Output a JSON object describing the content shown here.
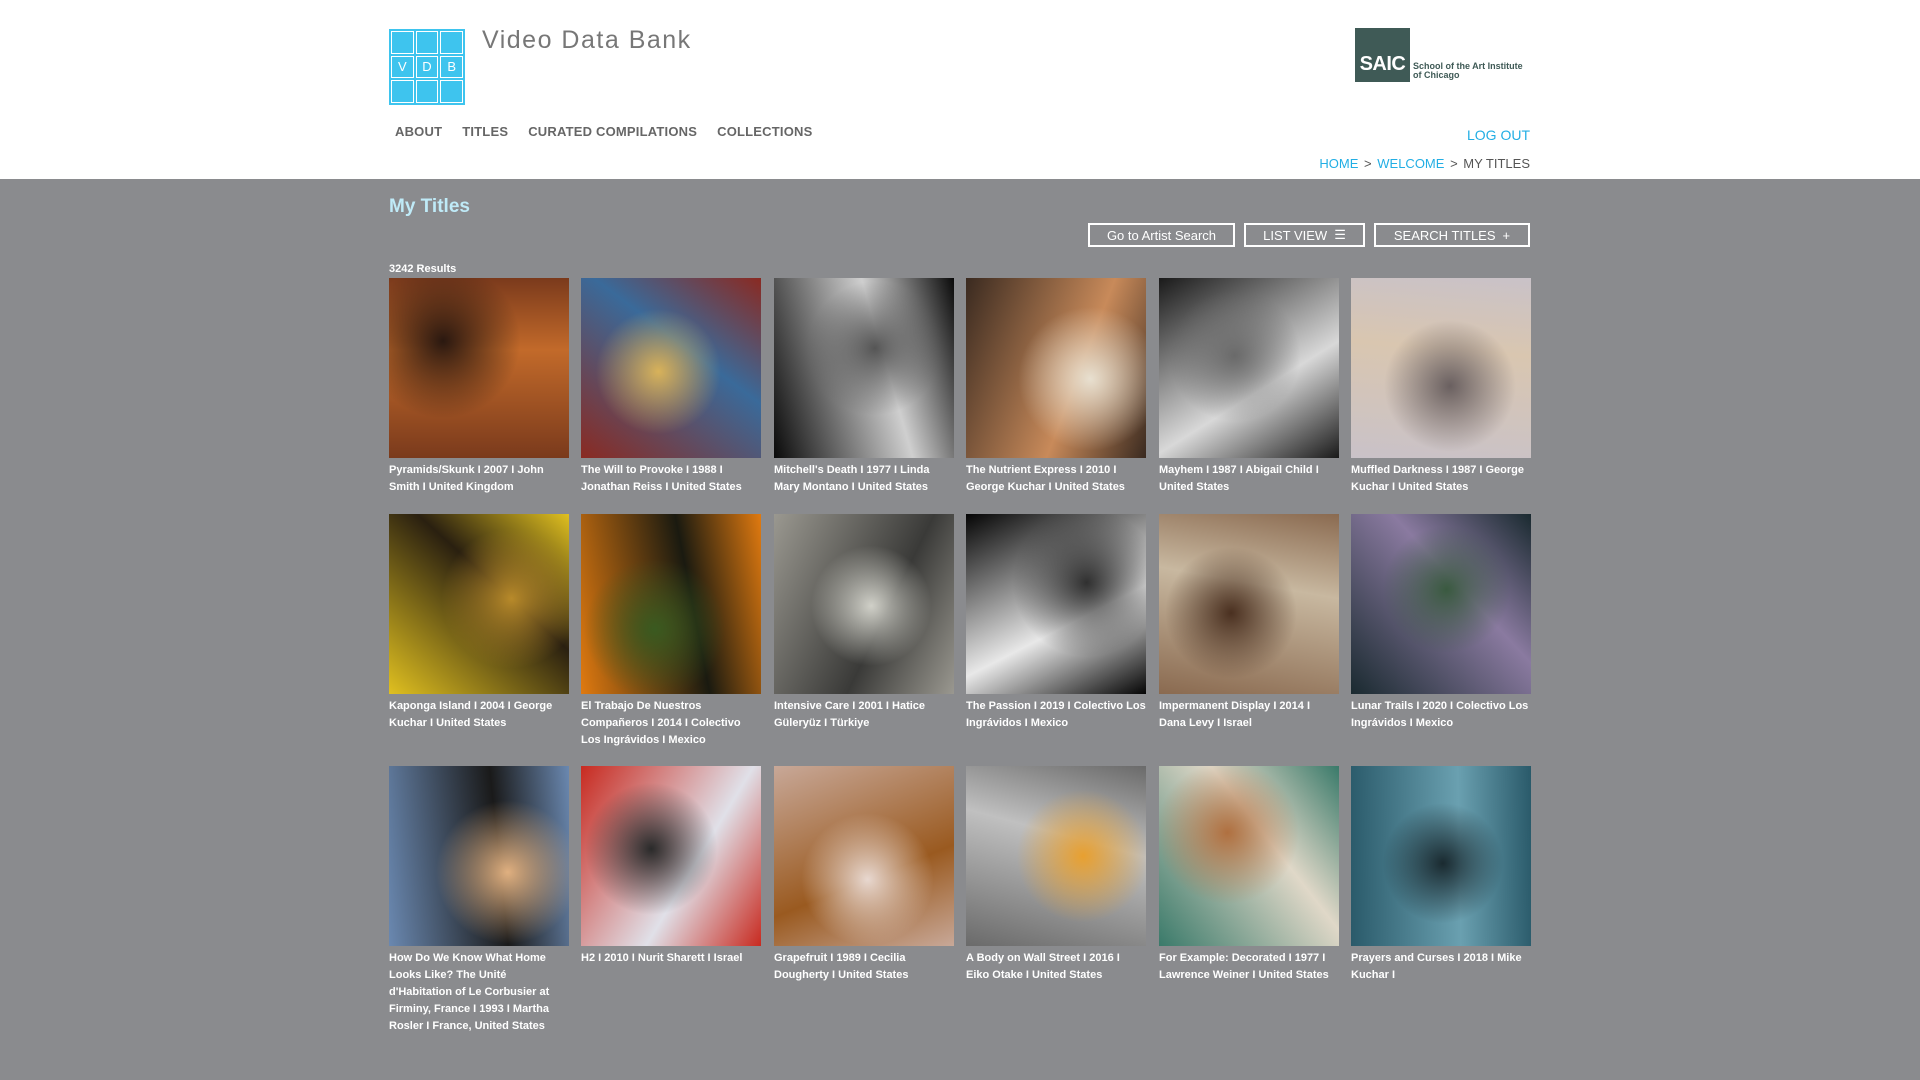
{
  "header": {
    "logo_letters": [
      "V",
      "D",
      "B"
    ],
    "site_title": "Video Data Bank",
    "partner_logo_text": "SAIC",
    "partner_name": "School of the Art Institute of Chicago",
    "nav": [
      {
        "label": "ABOUT"
      },
      {
        "label": "TITLES"
      },
      {
        "label": "CURATED COMPILATIONS"
      },
      {
        "label": "COLLECTIONS"
      }
    ],
    "logout_label": "LOG OUT",
    "breadcrumb": {
      "home": "HOME",
      "welcome": "WELCOME",
      "current": "MY TITLES",
      "separator": ">"
    }
  },
  "main": {
    "page_title": "My Titles",
    "toolbar": {
      "artist_search_label": "Go to Artist Search",
      "list_view_label": "LIST VIEW",
      "list_view_icon": "list-icon",
      "search_titles_label": "SEARCH TITLES",
      "search_titles_icon": "plus-icon"
    },
    "results_count": "3242 Results",
    "titles": [
      {
        "caption": "Pyramids/Skunk I 2007 I John Smith I United Kingdom",
        "palette": [
          "#7a3a1c",
          "#c26a2a",
          "#2a1810"
        ]
      },
      {
        "caption": "The Will to Provoke I 1988 I Jonathan Reiss I United States",
        "palette": [
          "#8a2a22",
          "#3a6a9a",
          "#d8b25a"
        ]
      },
      {
        "caption": "Mitchell's Death I 1977 I Linda Mary Montano I United States",
        "palette": [
          "#0a0a0a",
          "#cfcfcf",
          "#555555"
        ]
      },
      {
        "caption": "The Nutrient Express I 2010 I George Kuchar I United States",
        "palette": [
          "#3a2a20",
          "#c88a5a",
          "#e8e0d0"
        ]
      },
      {
        "caption": "Mayhem I 1987 I Abigail Child I United States",
        "palette": [
          "#1a1a1a",
          "#d8d8d8",
          "#6a6a6a"
        ]
      },
      {
        "caption": "Muffled Darkness I 1987 I George Kuchar I United States",
        "palette": [
          "#c9c2c8",
          "#d9c6b0",
          "#6a6060"
        ]
      },
      {
        "caption": "Kaponga Island I 2004 I George Kuchar I United States",
        "palette": [
          "#e0c020",
          "#2a2010",
          "#b88a2a"
        ]
      },
      {
        "caption": "El Trabajo De Nuestros Compañeros I 2014 I Colectivo Los Ingrávidos I Mexico",
        "palette": [
          "#e07a10",
          "#1a1a10",
          "#3a5a20"
        ]
      },
      {
        "caption": "Intensive Care I 2001 I Hatice Güleryüz I Türkiye",
        "palette": [
          "#9a9890",
          "#3a3a38",
          "#d0d0c8"
        ]
      },
      {
        "caption": "The Passion I 2019 I Colectivo Los Ingrávidos I Mexico",
        "palette": [
          "#050505",
          "#e8e8e8",
          "#303030"
        ]
      },
      {
        "caption": "Impermanent Display I 2014 I Dana Levy I Israel",
        "palette": [
          "#8a6a50",
          "#c8b8a0",
          "#4a3020"
        ]
      },
      {
        "caption": "Lunar Trails I 2020 I Colectivo Los Ingrávidos I Mexico",
        "palette": [
          "#1a2a30",
          "#8a7aa0",
          "#3a5a40"
        ]
      },
      {
        "caption": "How Do We Know What Home Looks Like? The Unité d'Habitation of Le Corbusier at Firminy, France I 1993 I Martha Rosler I France, United States",
        "palette": [
          "#6a88b0",
          "#1a1a1a",
          "#e0b080"
        ]
      },
      {
        "caption": "H2 I 2010 I Nurit Sharett I Israel",
        "palette": [
          "#c82a20",
          "#e0e0e8",
          "#2a2a2a"
        ]
      },
      {
        "caption": "Grapefruit I 1989 I Cecilia Dougherty I United States",
        "palette": [
          "#c8a898",
          "#9a5a20",
          "#e8d8d0"
        ]
      },
      {
        "caption": "A Body on Wall Street I 2016 I Eiko Otake I United States",
        "palette": [
          "#6a6a6a",
          "#c0c0c0",
          "#e8a030"
        ]
      },
      {
        "caption": "For Example: Decorated I 1977 I Lawrence Weiner I United States",
        "palette": [
          "#3a7a6a",
          "#e0d8c8",
          "#b07040"
        ]
      },
      {
        "caption": "Prayers and Curses I 2018 I Mike Kuchar I",
        "palette": [
          "#2a5a6a",
          "#6aa0b0",
          "#1a2a30"
        ]
      }
    ]
  }
}
